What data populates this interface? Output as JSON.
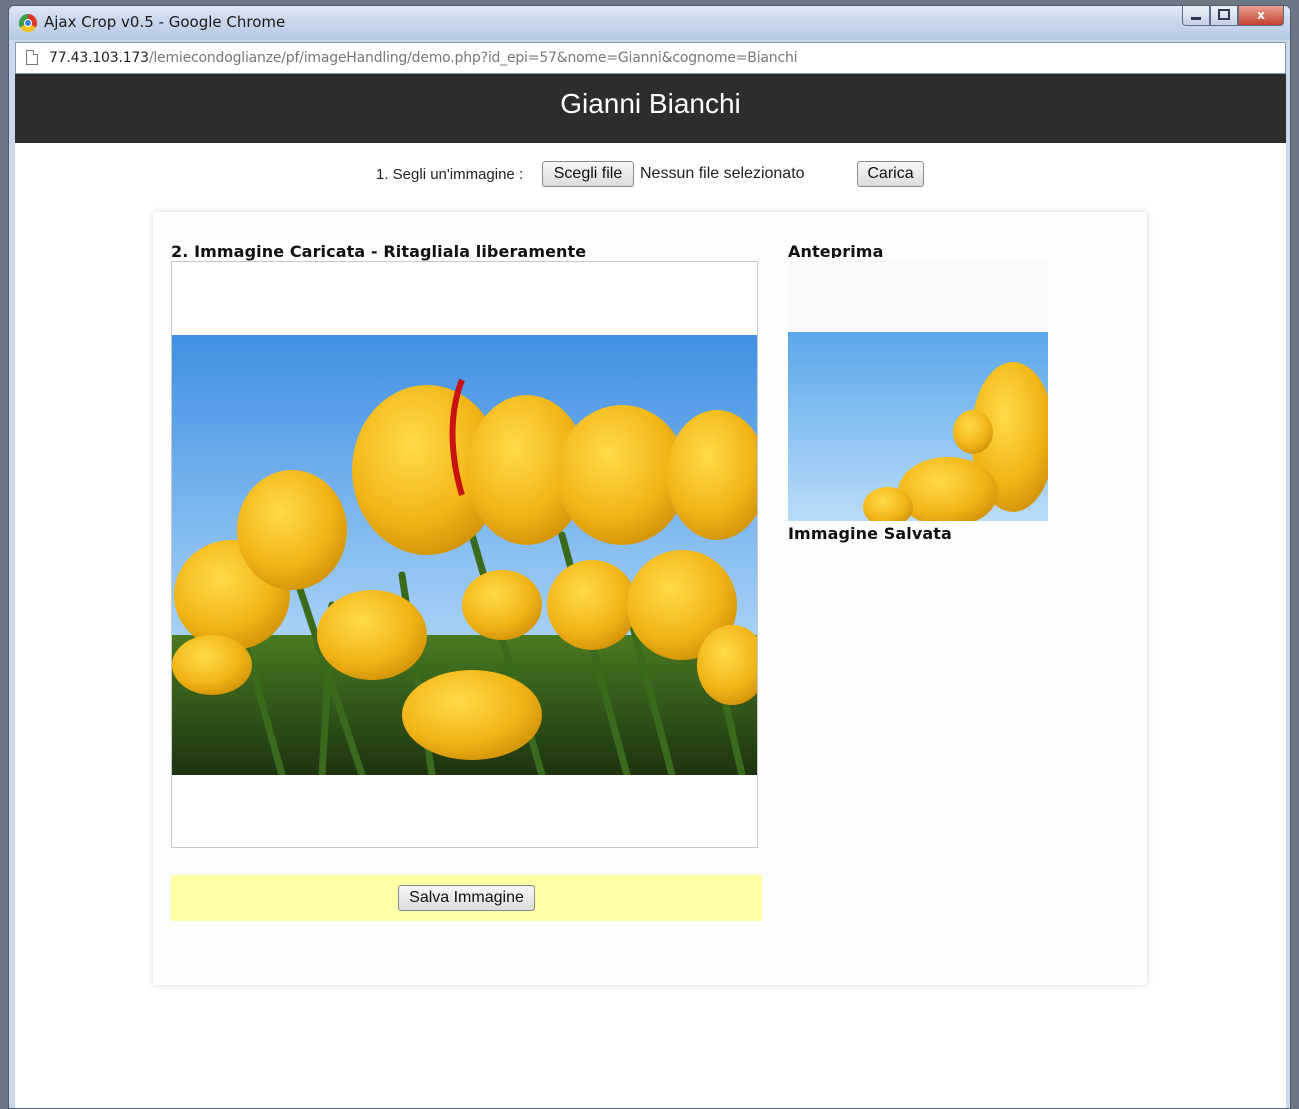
{
  "window": {
    "title": "Ajax Crop v0.5 - Google Chrome",
    "app_icon": "chrome-icon",
    "controls": [
      "minimize-icon",
      "maximize-icon",
      "close-icon"
    ],
    "close_glyph": "x"
  },
  "address_bar": {
    "host": "77.43.103.173",
    "path": "/lemiecondoglianze/pf/imageHandling/demo.php?id_epi=57&nome=Gianni&cognome=Bianchi"
  },
  "header": {
    "title": "Gianni Bianchi"
  },
  "upload": {
    "label": "1. Segli un'immagine :",
    "choose_button": "Scegli file",
    "no_file_text": "Nessun file selezionato",
    "upload_button": "Carica"
  },
  "editor": {
    "loaded_title": "2. Immagine Caricata - Ritagliala liberamente",
    "preview_title": "Anteprima",
    "saved_title": "Immagine Salvata",
    "save_button": "Salva Immagine",
    "image_subject": "yellow tulips against blue sky"
  },
  "colors": {
    "header_bg": "#2d2d2d",
    "save_bar_bg": "#ffffa6",
    "sky": "#5aa6e8",
    "tulip": "#f2b515"
  }
}
